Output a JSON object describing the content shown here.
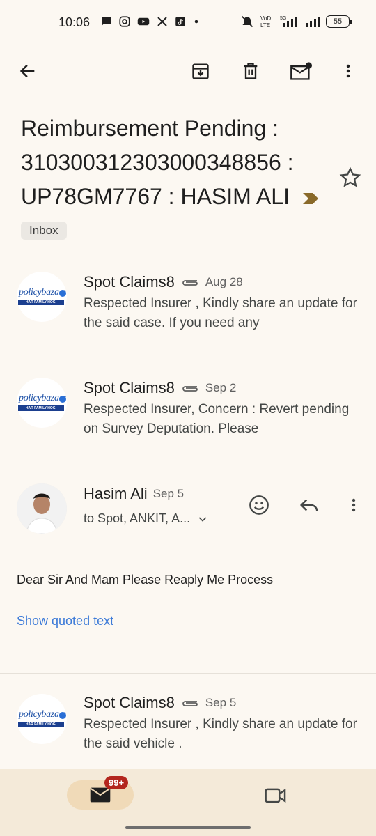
{
  "status_bar": {
    "time": "10:06",
    "battery": "55",
    "network": "5G",
    "icons": [
      "chat-bubble-icon",
      "instagram-icon",
      "youtube-icon",
      "x-icon",
      "tiktok-icon",
      "dot-icon"
    ]
  },
  "app_bar": {
    "icons": [
      "back-arrow-icon",
      "archive-icon",
      "delete-icon",
      "mark-unread-icon",
      "more-vert-icon"
    ]
  },
  "subject": {
    "text": "Reimbursement Pending : 310300312303000348856 : UP78GM7767 : HASIM ALI",
    "label": "Inbox",
    "marker_color": "#8a6a2a"
  },
  "messages": [
    {
      "sender": "Spot Claims8",
      "date": "Aug 28",
      "has_attachment": true,
      "avatar_brand": "policybazaar",
      "avatar_tag": "HAR FAMILY HOGI INSURED",
      "snippet": "Respected Insurer , Kindly share an update for the said case. If you need any"
    },
    {
      "sender": "Spot Claims8",
      "date": "Sep 2",
      "has_attachment": true,
      "avatar_brand": "policybazaar",
      "avatar_tag": "HAR FAMILY HOGI INSURED",
      "snippet": "Respected Insurer, Concern : Revert pending on Survey Deputation. Please"
    },
    {
      "sender": "Hasim Ali",
      "date": "Sep 5",
      "recipients": "to Spot, ANKIT, A...",
      "body": "Dear Sir And Mam Please Reaply Me Process",
      "show_quoted": "Show quoted text"
    },
    {
      "sender": "Spot Claims8",
      "date": "Sep 5",
      "has_attachment": true,
      "avatar_brand": "policybazaar",
      "avatar_tag": "HAR FAMILY HOGI INSURED",
      "snippet": "Respected Insurer , Kindly share an update for the said vehicle ."
    }
  ],
  "bottom_nav": {
    "mail_badge": "99+"
  },
  "colors": {
    "background": "#fcf8f2",
    "link": "#3d7bd8",
    "badge": "#b3261e",
    "nav_bg": "#f4ead9"
  }
}
